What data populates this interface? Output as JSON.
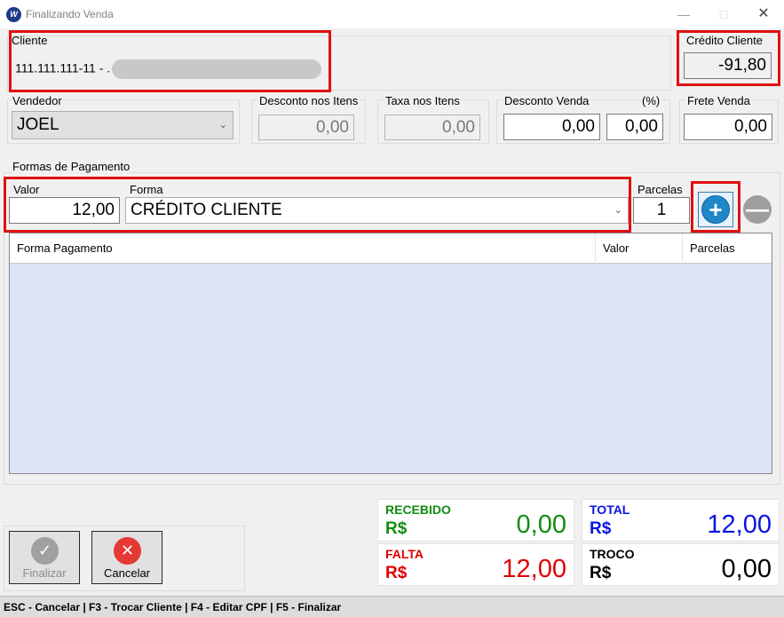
{
  "window": {
    "title": "Finalizando Venda",
    "icon": "app-logo-icon"
  },
  "cliente": {
    "label": "Cliente",
    "value": "111.111.111-11 - ."
  },
  "credito_cliente": {
    "label": "Crédito Cliente",
    "value": "-91,80"
  },
  "vendedor": {
    "label": "Vendedor",
    "value": "JOEL"
  },
  "desconto_itens": {
    "label": "Desconto nos Itens",
    "value": "0,00"
  },
  "taxa_itens": {
    "label": "Taxa nos Itens",
    "value": "0,00"
  },
  "desconto_venda": {
    "label": "Desconto Venda",
    "value": "0,00",
    "pct_label": "(%)",
    "pct_value": "0,00"
  },
  "frete_venda": {
    "label": "Frete Venda",
    "value": "0,00"
  },
  "formas_pagamento": {
    "group_label": "Formas de Pagamento",
    "valor_label": "Valor",
    "valor_value": "12,00",
    "forma_label": "Forma",
    "forma_value": "CRÉDITO CLIENTE",
    "parcelas_label": "Parcelas",
    "parcelas_value": "1",
    "add_icon": "plus-icon",
    "remove_icon": "minus-icon"
  },
  "grid": {
    "columns": [
      "Forma Pagamento",
      "Valor",
      "Parcelas"
    ],
    "rows": []
  },
  "totals": {
    "recebido": {
      "label": "RECEBIDO",
      "currency": "R$",
      "value": "0,00",
      "color": "#118c11"
    },
    "total": {
      "label": "TOTAL",
      "currency": "R$",
      "value": "12,00",
      "color": "#0a14e0"
    },
    "falta": {
      "label": "FALTA",
      "currency": "R$",
      "value": "12,00",
      "color": "#e00000"
    },
    "troco": {
      "label": "TROCO",
      "currency": "R$",
      "value": "0,00",
      "color": "#000000"
    }
  },
  "actions": {
    "finalizar": {
      "label": "Finalizar",
      "icon": "check-icon"
    },
    "cancelar": {
      "label": "Cancelar",
      "icon": "close-icon"
    }
  },
  "status_bar": {
    "text": "ESC - Cancelar | F3 - Trocar Cliente | F4 - Editar CPF | F5 - Finalizar"
  }
}
